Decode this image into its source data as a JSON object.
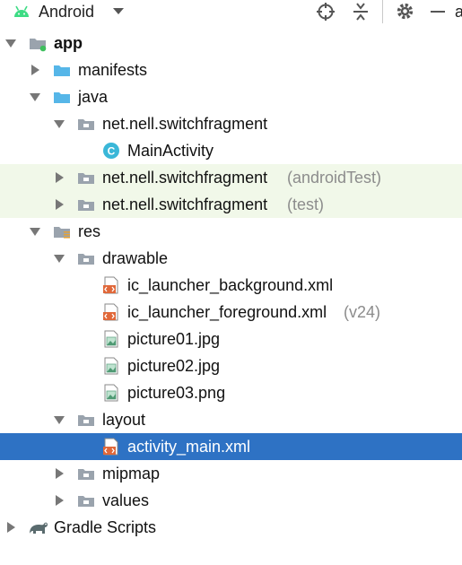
{
  "toolbar": {
    "view_label": "Android",
    "cut_text": "a"
  },
  "colors": {
    "selection": "#2e72c4",
    "highlight_rows": "#f1f8e9",
    "folder_blue": "#56b6e8",
    "package_gray": "#9aa3ad",
    "xml_orange": "#e0683a",
    "class_cyan": "#3ab7d8"
  },
  "tree": [
    {
      "label": "app",
      "icon": "module-folder-icon",
      "expanded": true
    },
    {
      "label": "manifests",
      "icon": "folder-icon",
      "expanded": false
    },
    {
      "label": "java",
      "icon": "folder-icon",
      "expanded": true
    },
    {
      "label": "net.nell.switchfragment",
      "icon": "package-icon",
      "expanded": true
    },
    {
      "label": "MainActivity",
      "icon": "class-icon"
    },
    {
      "label": "net.nell.switchfragment",
      "suffix": "(androidTest)",
      "icon": "package-icon",
      "expanded": false
    },
    {
      "label": "net.nell.switchfragment",
      "suffix": "(test)",
      "icon": "package-icon",
      "expanded": false
    },
    {
      "label": "res",
      "icon": "resource-folder-icon",
      "expanded": true
    },
    {
      "label": "drawable",
      "icon": "package-icon",
      "expanded": true
    },
    {
      "label": "ic_launcher_background.xml",
      "icon": "xml-file-icon"
    },
    {
      "label": "ic_launcher_foreground.xml",
      "suffix": "(v24)",
      "icon": "xml-file-icon"
    },
    {
      "label": "picture01.jpg",
      "icon": "image-file-icon"
    },
    {
      "label": "picture02.jpg",
      "icon": "image-file-icon"
    },
    {
      "label": "picture03.png",
      "icon": "image-file-icon"
    },
    {
      "label": "layout",
      "icon": "package-icon",
      "expanded": true
    },
    {
      "label": "activity_main.xml",
      "icon": "xml-file-icon",
      "selected": true
    },
    {
      "label": "mipmap",
      "icon": "package-icon",
      "expanded": false
    },
    {
      "label": "values",
      "icon": "package-icon",
      "expanded": false
    },
    {
      "label": "Gradle Scripts",
      "icon": "gradle-icon",
      "expanded": false
    }
  ]
}
